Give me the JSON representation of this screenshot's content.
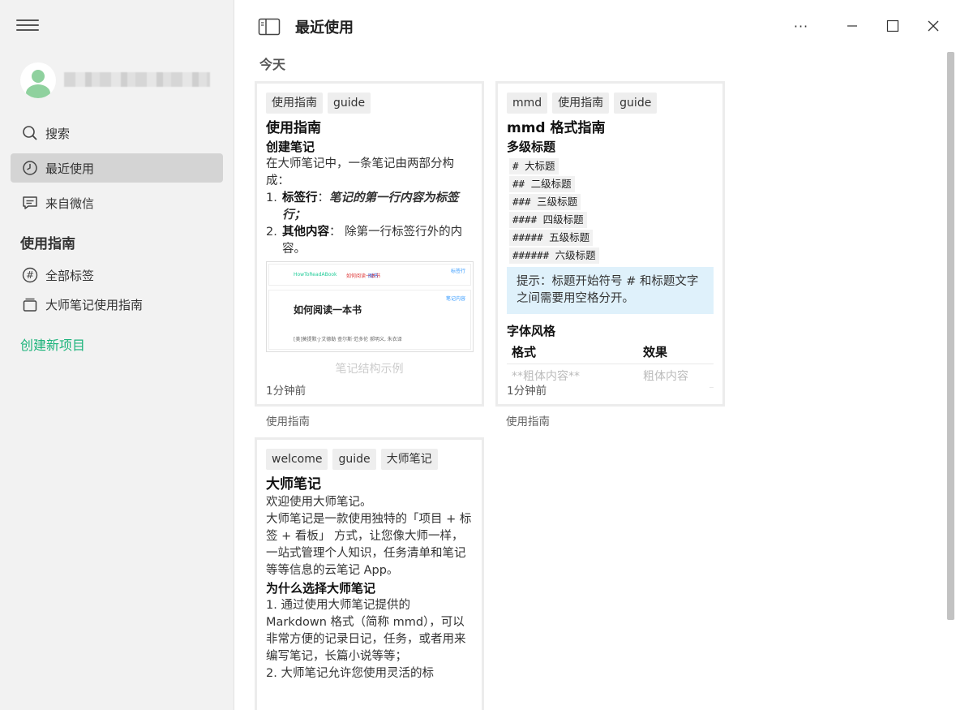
{
  "sidebar": {
    "search_label": "搜索",
    "recent_label": "最近使用",
    "wechat_label": "来自微信",
    "section_title": "使用指南",
    "all_tags_label": "全部标签",
    "project_label": "大师笔记使用指南",
    "create_label": "创建新项目"
  },
  "header": {
    "title": "最近使用",
    "more": "···"
  },
  "date_group": "今天",
  "cards": [
    {
      "tags": [
        "使用指南",
        "guide"
      ],
      "title": "使用指南",
      "subtitle": "创建笔记",
      "intro": "在大师笔记中，一条笔记由两部分构成：",
      "item1_num": "1.",
      "item1_bold": "标签行",
      "item1_sep": "：",
      "item1_italic": "笔记的第一行内容为标签行；",
      "item2_num": "2.",
      "item2_bold": "其他内容",
      "item2_text": "： 除第一行标签行外的内容。",
      "thumb_tag_label": "标签行",
      "thumb_content_label": "笔记内容",
      "thumb_title": "如何阅读一本书",
      "thumb_author": "[美]莫提默·J·艾德勒 查尔斯·范多伦 郝明义, 朱衣译",
      "thumb_tag1": "HowToReadABook",
      "thumb_tag2": "如何阅读一本书",
      "thumb_tag3": "图书",
      "caption": "笔记结构示例",
      "time": "1分钟前",
      "project": "使用指南"
    },
    {
      "tags": [
        "mmd",
        "使用指南",
        "guide"
      ],
      "title": "mmd 格式指南",
      "subtitle": "多级标题",
      "codes": [
        "# 大标题",
        "## 二级标题",
        "### 三级标题",
        "#### 四级标题",
        "##### 五级标题",
        "###### 六级标题"
      ],
      "tip": "提示：标题开始符号 # 和标题文字之间需要用空格分开。",
      "font_style_title": "字体风格",
      "table_head_format": "格式",
      "table_head_effect": "效果",
      "table_row_format": "**粗体内容**",
      "table_row_effect": "粗体内容",
      "time": "1分钟前",
      "project": "使用指南"
    },
    {
      "tags": [
        "welcome",
        "guide",
        "大师笔记"
      ],
      "title": "大师笔记",
      "p1": "欢迎使用大师笔记。",
      "p2": "大师笔记是一款使用独特的「项目 + 标签 + 看板」 方式，让您像大师一样，一站式管理个人知识，任务清单和笔记等等信息的云笔记 App。",
      "subtitle": "为什么选择大师笔记",
      "p3": "1. 通过使用大师笔记提供的 Markdown 格式（简称 mmd），可以非常方便的记录日记，任务，或者用来编写笔记，长篇小说等等；",
      "p4": "2. 大师笔记允许您使用灵活的标"
    }
  ]
}
